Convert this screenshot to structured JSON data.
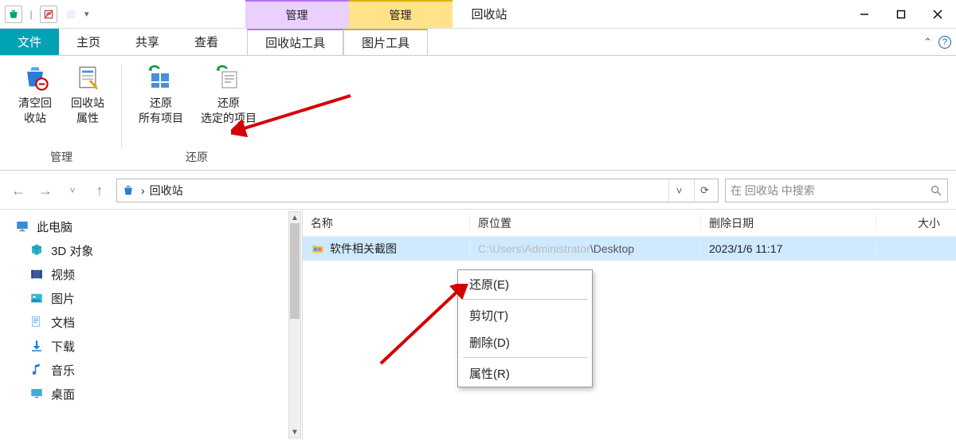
{
  "window": {
    "title": "回收站",
    "contextual_tabs": {
      "manage1": "管理",
      "manage2": "管理"
    },
    "qat_dropdown": "▾"
  },
  "tabs": {
    "file": "文件",
    "home": "主页",
    "share": "共享",
    "view": "查看",
    "recycle_tools": "回收站工具",
    "picture_tools": "图片工具",
    "collapse_glyph": "⌃"
  },
  "ribbon": {
    "empty_bin": "清空回\n收站",
    "bin_props": "回收站\n属性",
    "restore_all": "还原\n所有项目",
    "restore_selected": "还原\n选定的项目",
    "group_manage": "管理",
    "group_restore": "还原"
  },
  "nav": {
    "back": "←",
    "forward": "→",
    "recent": "˅",
    "up": "↑",
    "crumb_sep": "›",
    "location": "回收站",
    "addr_dropdown": "˅",
    "refresh": "⟳"
  },
  "search": {
    "placeholder": "在 回收站 中搜索"
  },
  "sidebar": {
    "items": [
      {
        "label": "此电脑",
        "icon": "pc"
      },
      {
        "label": "3D 对象",
        "icon": "3d"
      },
      {
        "label": "视频",
        "icon": "video"
      },
      {
        "label": "图片",
        "icon": "pictures"
      },
      {
        "label": "文档",
        "icon": "docs"
      },
      {
        "label": "下载",
        "icon": "downloads"
      },
      {
        "label": "音乐",
        "icon": "music"
      },
      {
        "label": "桌面",
        "icon": "desktop"
      }
    ]
  },
  "columns": {
    "name": "名称",
    "orig": "原位置",
    "deleted": "删除日期",
    "size": "大小"
  },
  "rows": [
    {
      "name": "软件相关截图",
      "orig_prefix": "C:\\Users\\A",
      "orig_dim": "dministrator",
      "orig_suffix": "\\Desktop",
      "deleted": "2023/1/6 11:17",
      "size": ""
    }
  ],
  "context_menu": {
    "restore": "还原(E)",
    "cut": "剪切(T)",
    "delete": "删除(D)",
    "properties": "属性(R)"
  }
}
